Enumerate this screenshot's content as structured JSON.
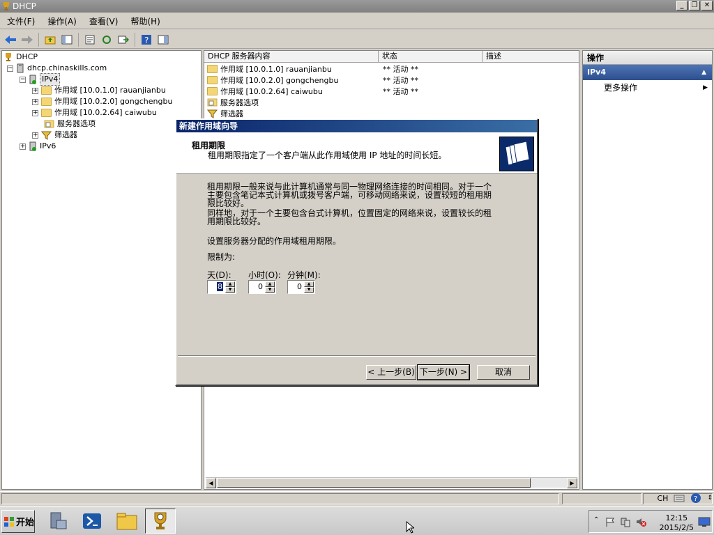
{
  "window": {
    "title": "DHCP"
  },
  "window_buttons": {
    "minimize": "_",
    "restore": "❐",
    "close": "✕"
  },
  "menu": [
    "文件(F)",
    "操作(A)",
    "查看(V)",
    "帮助(H)"
  ],
  "tree": {
    "root": "DHCP",
    "server": "dhcp.chinaskills.com",
    "ipv4": "IPv4",
    "scopes": [
      "作用域 [10.0.1.0] rauanjianbu",
      "作用域 [10.0.2.0] gongchengbu",
      "作用域 [10.0.2.64] caiwubu"
    ],
    "server_options": "服务器选项",
    "filters": "筛选器",
    "ipv6": "IPv6"
  },
  "list": {
    "columns": [
      "DHCP 服务器内容",
      "状态",
      "描述"
    ],
    "rows": [
      {
        "name": "作用域 [10.0.1.0] rauanjianbu",
        "status": "** 活动 **"
      },
      {
        "name": "作用域 [10.0.2.0] gongchengbu",
        "status": "** 活动 **"
      },
      {
        "name": "作用域 [10.0.2.64] caiwubu",
        "status": "** 活动 **"
      },
      {
        "name": "服务器选项",
        "status": ""
      },
      {
        "name": "筛选器",
        "status": ""
      }
    ]
  },
  "actions": {
    "header": "操作",
    "section": "IPv4",
    "more": "更多操作"
  },
  "dialog": {
    "title": "新建作用域向导",
    "heading": "租用期限",
    "subheading": "租用期限指定了一个客户端从此作用域使用 IP 地址的时间长短。",
    "para1_l1": "租用期限一般来说与此计算机通常与同一物理网络连接的时间相同。对于一个",
    "para1_l2": "主要包含笔记本式计算机或拨号客户端，可移动网络来说，设置较短的租用期",
    "para1_l3": "限比较好。",
    "para2_l1": "同样地，对于一个主要包含台式计算机，位置固定的网络来说，设置较长的租",
    "para2_l2": "用期限比较好。",
    "set_text": "设置服务器分配的作用域租用期限。",
    "limit_label": "限制为:",
    "days_label": "天(D):",
    "hours_label": "小时(O):",
    "minutes_label": "分钟(M):",
    "days_value": "8",
    "hours_value": "0",
    "minutes_value": "0",
    "back": "< 上一步(B)",
    "next": "下一步(N) >",
    "cancel": "取消"
  },
  "taskbar": {
    "start": "开始",
    "clock_time": "12:15",
    "clock_date": "2015/2/5",
    "ime": "CH"
  }
}
